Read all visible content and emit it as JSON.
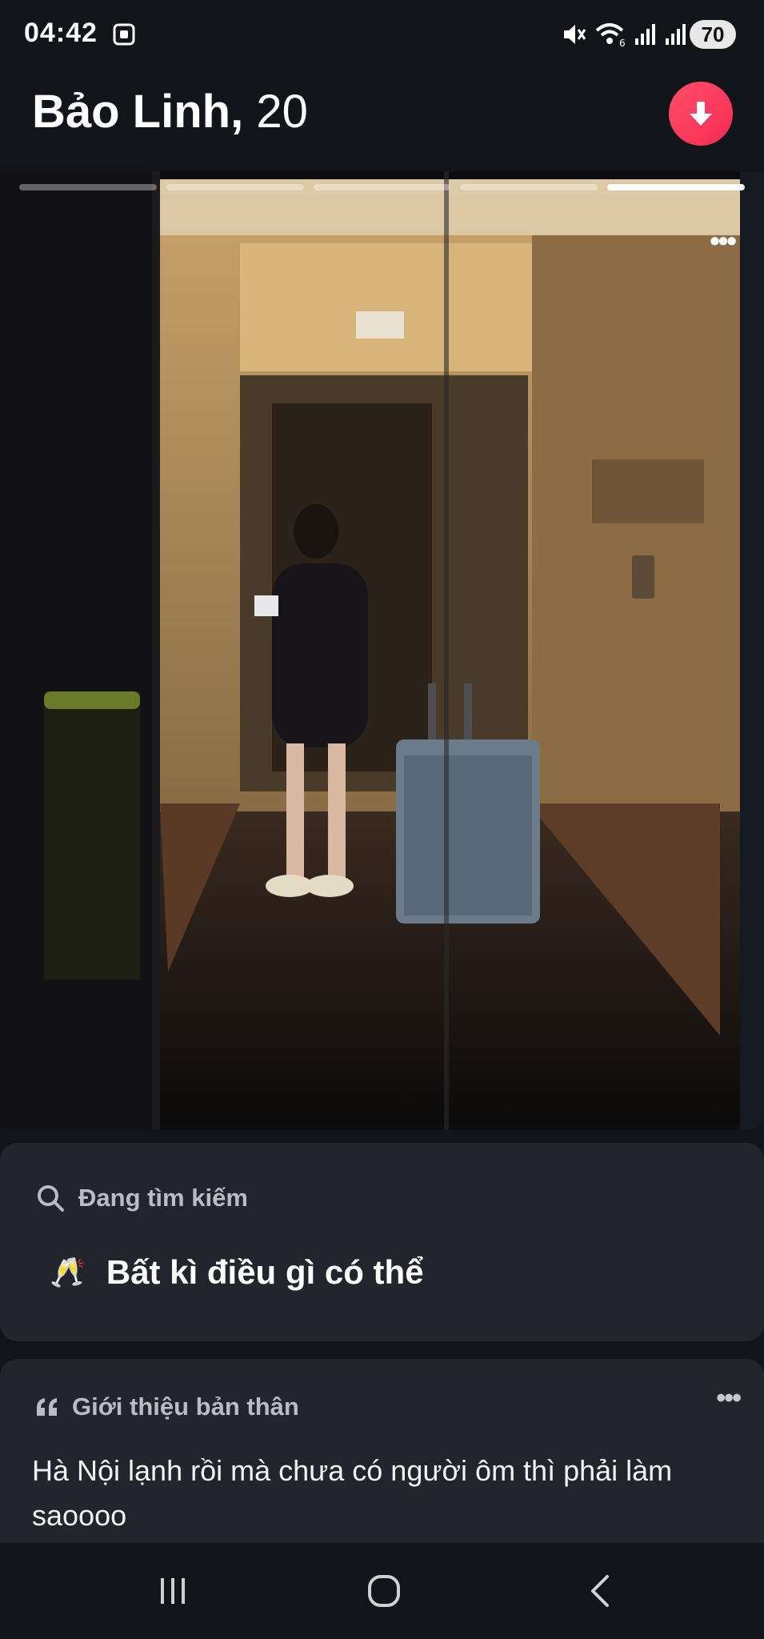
{
  "status_bar": {
    "time": "04:42",
    "battery": "70",
    "icons": [
      "screen-record-icon",
      "mute-icon",
      "wifi-icon",
      "signal-icon",
      "signal-icon"
    ]
  },
  "header": {
    "name": "Bảo Linh,",
    "age": "20",
    "collapse_icon": "arrow-down-icon",
    "accent_color": "#fd3d5f"
  },
  "photo": {
    "total": 5,
    "current": 5,
    "menu_icon": "more-dots-icon"
  },
  "looking_for": {
    "heading": "Đang tìm kiếm",
    "heading_icon": "search-icon",
    "value_emoji": "🥂",
    "value": "Bất kì điều gì có thể"
  },
  "about": {
    "heading": "Giới thiệu bản thân",
    "heading_icon": "quote-icon",
    "menu_icon": "more-dots-icon",
    "text": "Hà Nội lạnh rồi mà chưa có người ôm thì phải làm saoooo"
  },
  "nav_bar": {
    "buttons": [
      "recents-icon",
      "home-icon",
      "back-icon"
    ]
  }
}
